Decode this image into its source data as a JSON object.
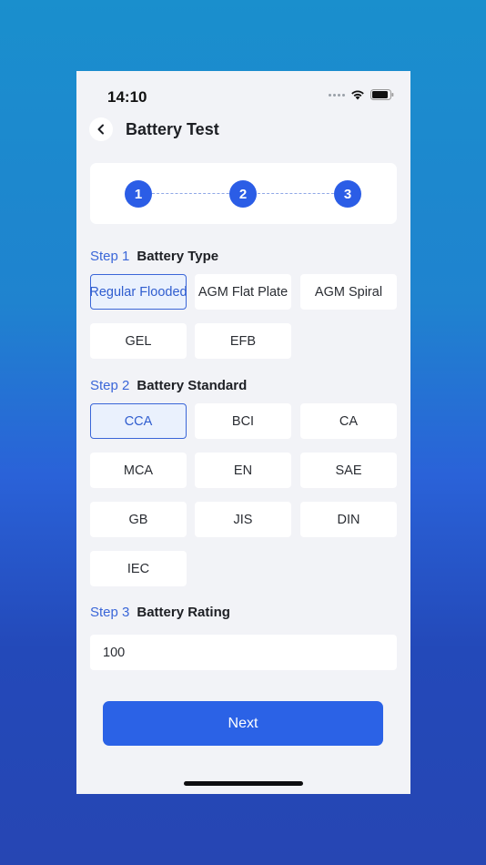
{
  "status": {
    "time": "14:10"
  },
  "header": {
    "title": "Battery Test"
  },
  "stepper": {
    "steps": [
      "1",
      "2",
      "3"
    ]
  },
  "step1": {
    "number": "Step 1",
    "title": "Battery Type",
    "options": [
      "Regular Flooded",
      "AGM Flat Plate",
      "AGM Spiral",
      "GEL",
      "EFB"
    ],
    "selected": "Regular Flooded"
  },
  "step2": {
    "number": "Step 2",
    "title": "Battery Standard",
    "options": [
      "CCA",
      "BCI",
      "CA",
      "MCA",
      "EN",
      "SAE",
      "GB",
      "JIS",
      "DIN",
      "IEC"
    ],
    "selected": "CCA"
  },
  "step3": {
    "number": "Step 3",
    "title": "Battery Rating",
    "value": "100"
  },
  "next_button": {
    "label": "Next"
  },
  "colors": {
    "accent": "#2b62e6",
    "selected_bg": "#eaf1fd",
    "screen_bg": "#f2f3f7"
  }
}
